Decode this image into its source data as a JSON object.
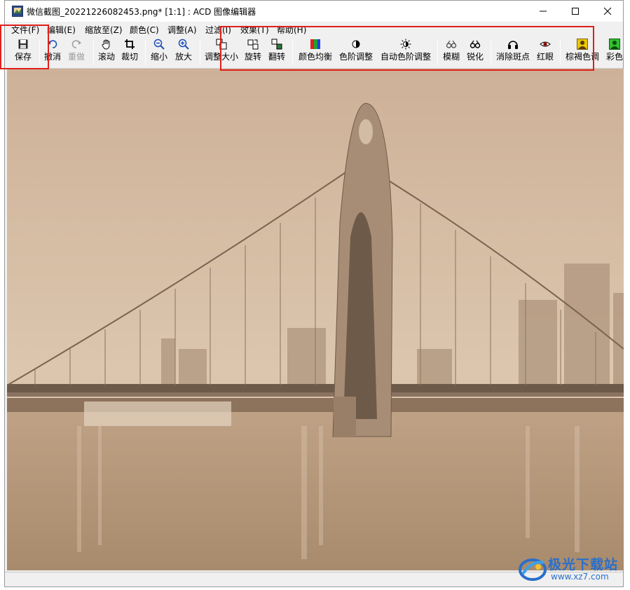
{
  "window": {
    "title": "微信截图_20221226082453.png* [1:1] : ACD 图像编辑器"
  },
  "menu": [
    "文件(F)",
    "编辑(E)",
    "缩放至(Z)",
    "颜色(C)",
    "调整(A)",
    "过滤(I)",
    "效果(T)",
    "帮助(H)"
  ],
  "toolbar": {
    "save": "保存",
    "undo": "撤消",
    "redo": "重做",
    "scroll": "滚动",
    "crop": "裁切",
    "zoom_out": "缩小",
    "zoom_in": "放大",
    "resize": "调整大小",
    "rotate": "旋转",
    "flip": "翻转",
    "color_balance": "颜色均衡",
    "levels": "色阶调整",
    "auto_levels": "自动色阶调整",
    "blur": "模糊",
    "sharpen": "锐化",
    "despeckle": "消除斑点",
    "red_eye": "红眼",
    "sepia": "棕褐色调",
    "colorize": "彩色"
  },
  "watermark": {
    "title": "极光下载站",
    "url": "www.xz7.com"
  },
  "colors": {
    "highlight_box": "#e0201b",
    "sepia_light": "#d8c0a8",
    "sepia_dark": "#6e5a48"
  }
}
